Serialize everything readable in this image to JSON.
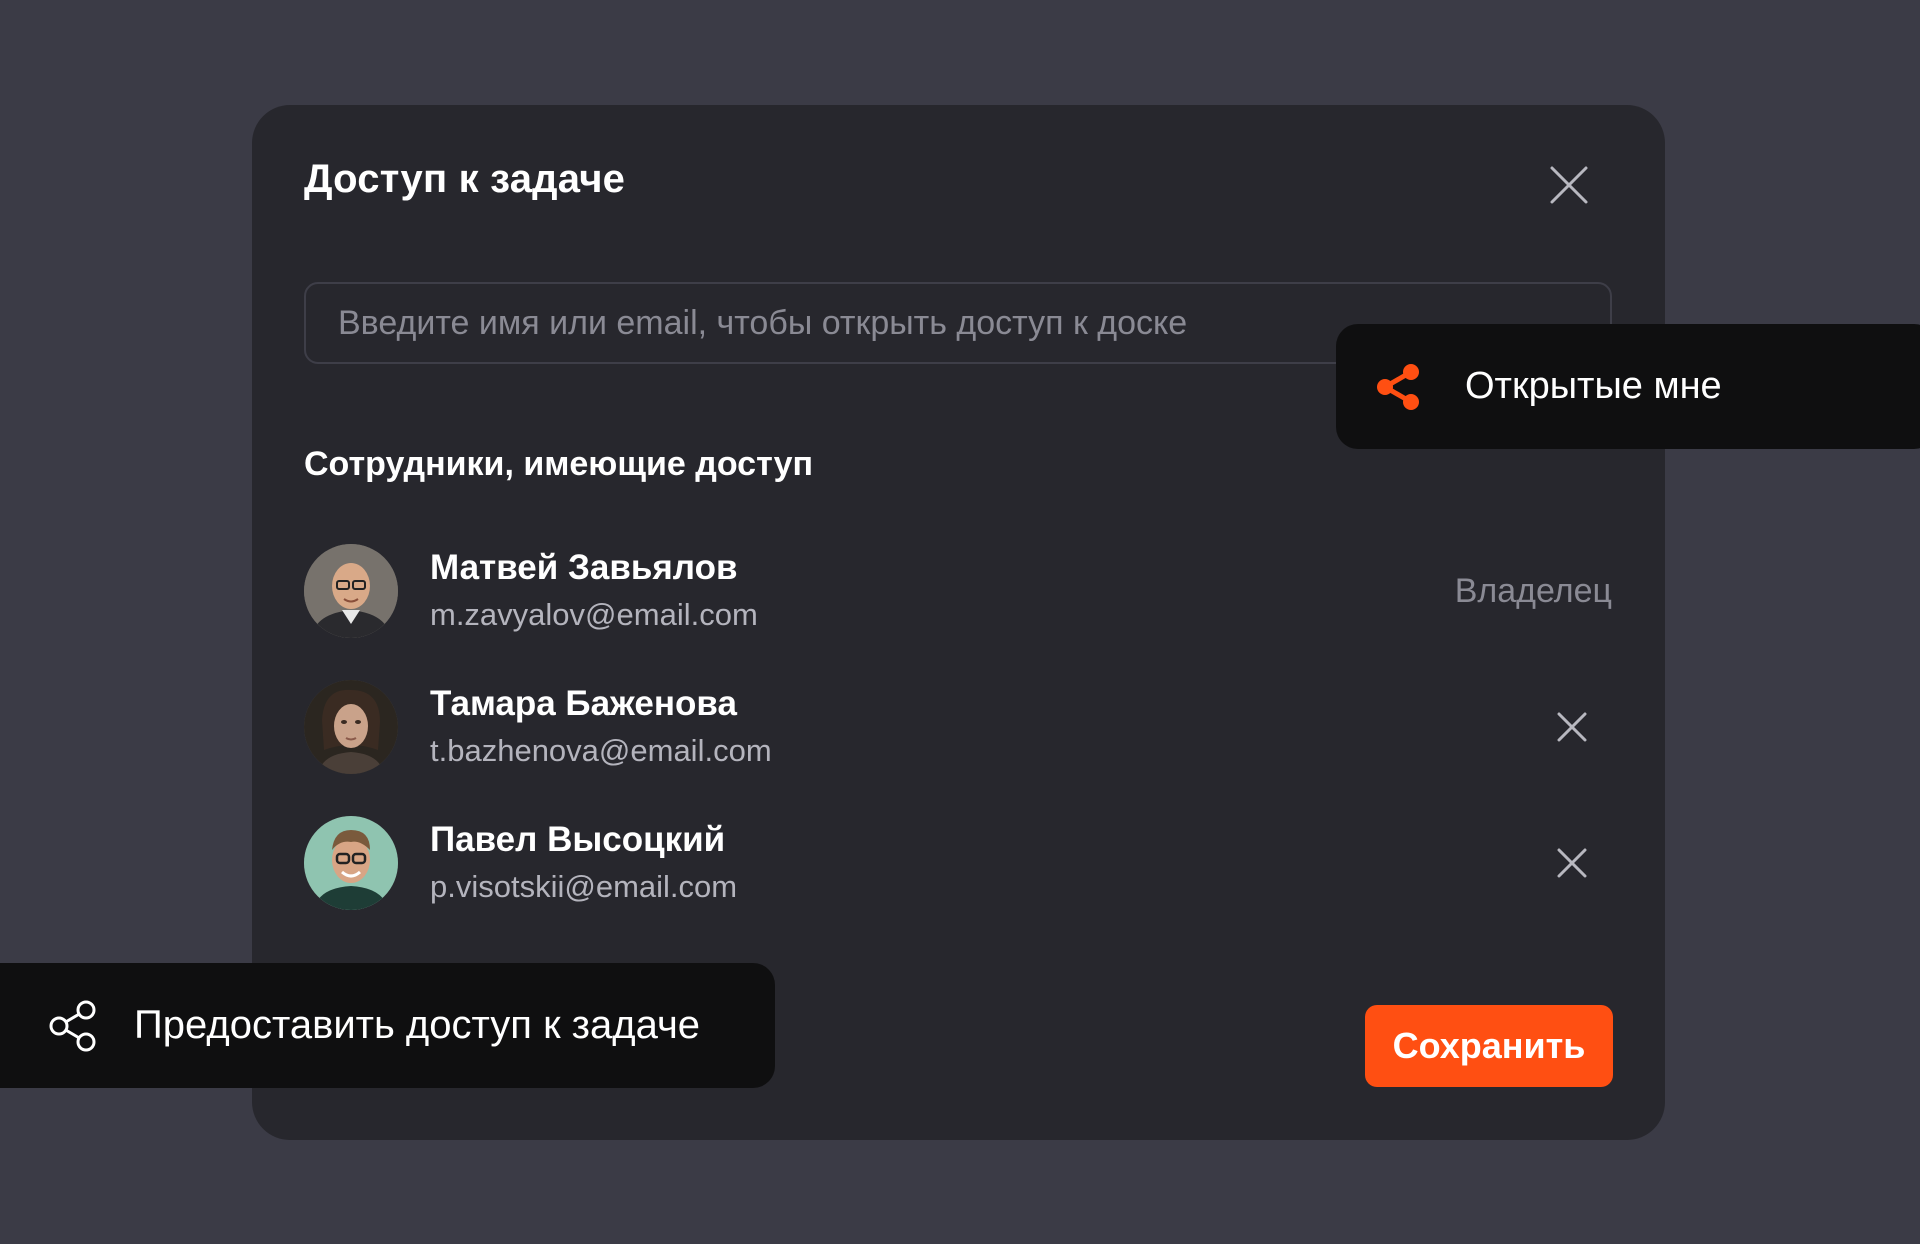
{
  "modal": {
    "title": "Доступ к задаче",
    "search_placeholder": "Введите имя или email, чтобы открыть доступ к доске",
    "section_title": "Сотрудники, имеющие доступ",
    "users": [
      {
        "name": "Матвей Завьялов",
        "email": "m.zavyalov@email.com",
        "role": "Владелец"
      },
      {
        "name": "Тамара Баженова",
        "email": "t.bazhenova@email.com"
      },
      {
        "name": "Павел Высоцкий",
        "email": "p.visotskii@email.com"
      }
    ],
    "save_label": "Сохранить"
  },
  "badges": {
    "shared_with_me": "Открытые мне",
    "grant_access": "Предоставить доступ к задаче"
  },
  "colors": {
    "background": "#3b3b46",
    "modal": "#27272d",
    "accent": "#ff4f12",
    "pill": "#0f0f10"
  },
  "icons": {
    "close": "close-icon",
    "remove": "close-icon",
    "share_filled": "share-icon",
    "share_outline": "share-icon"
  }
}
